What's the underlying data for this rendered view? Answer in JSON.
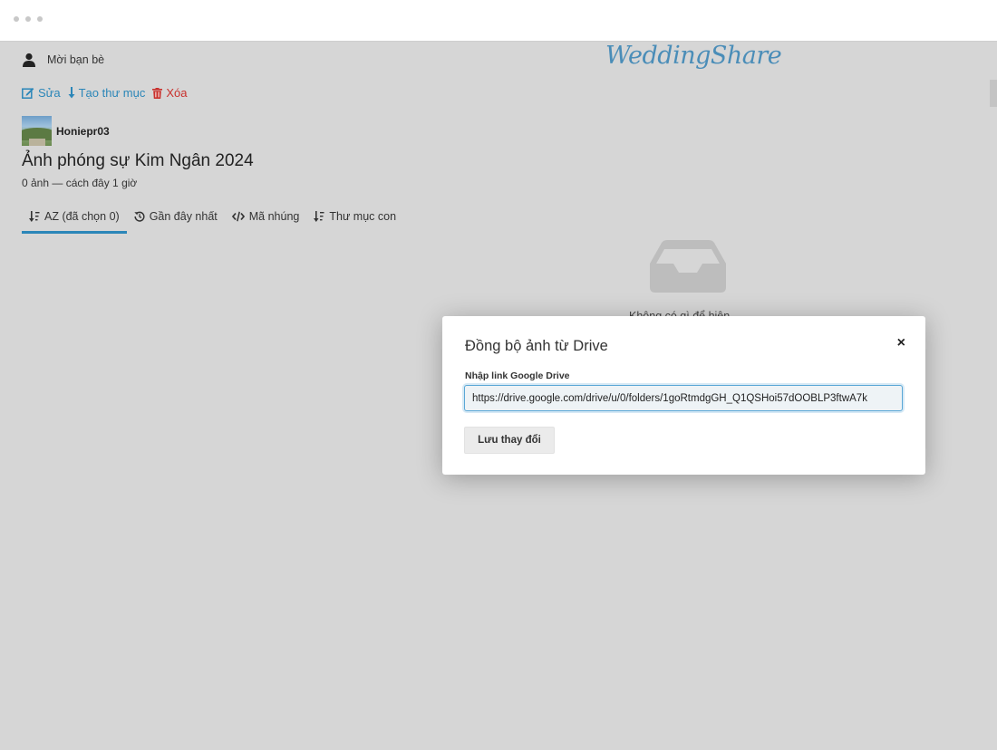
{
  "header": {
    "invite_label": "Mời bạn bè",
    "logo_main": "Wedding",
    "logo_sub": "Share"
  },
  "actions": {
    "edit": "Sửa",
    "new_folder": "Tạo thư mục",
    "delete": "Xóa"
  },
  "album": {
    "owner": "Honiepr03",
    "title": "Ảnh phóng sự Kim Ngân 2024",
    "meta": "0 ảnh — cách đây 1 giờ"
  },
  "tabs": [
    {
      "label": "AZ (đã chọn 0)",
      "active": true
    },
    {
      "label": "Gần đây nhất",
      "active": false
    },
    {
      "label": "Mã nhúng",
      "active": false
    },
    {
      "label": "Thư mục con",
      "active": false
    }
  ],
  "empty_state": {
    "text": "Không có gì để hiện"
  },
  "modal": {
    "title": "Đồng bộ ảnh từ Drive",
    "close_symbol": "×",
    "field_label": "Nhập link Google Drive",
    "field_value": "https://drive.google.com/drive/u/0/folders/1goRtmdgGH_Q1QSHoi57dOOBLP3ftwA7k",
    "save_label": "Lưu thay đổi"
  },
  "colors": {
    "accent": "#2b86b8",
    "danger": "#c9302c",
    "page_bg": "#d6d6d6"
  }
}
